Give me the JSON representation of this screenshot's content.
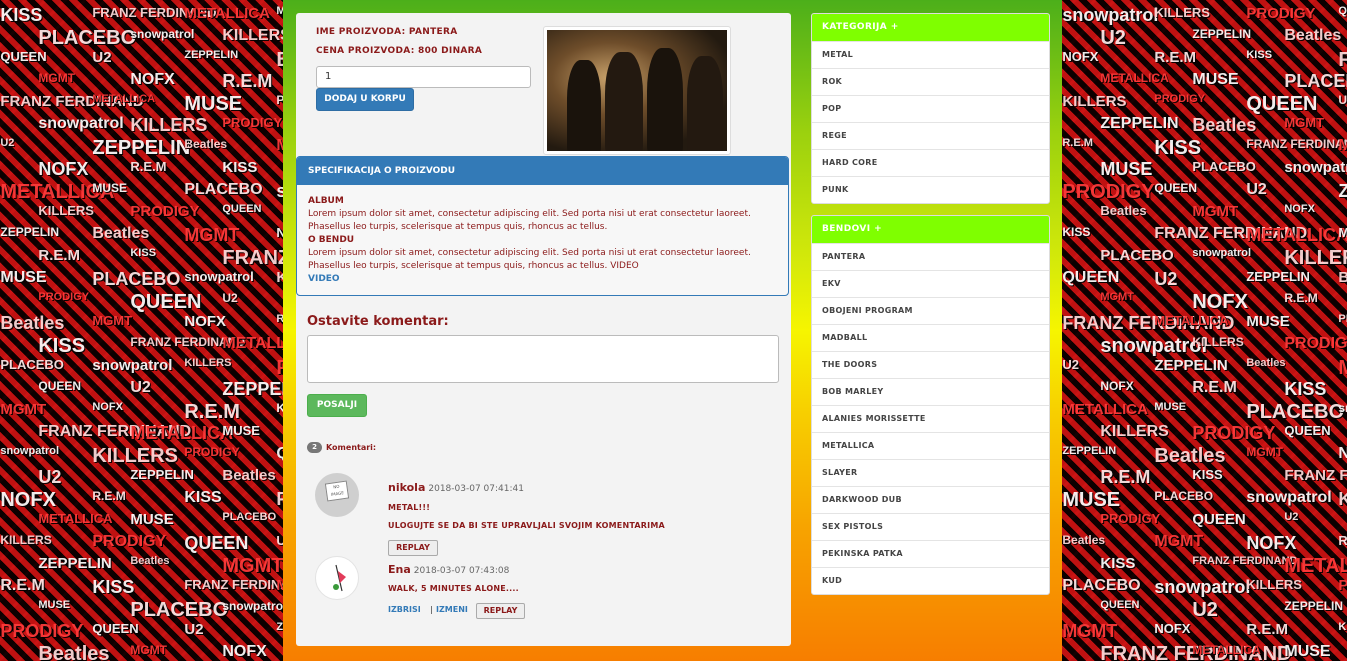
{
  "product": {
    "name_line": "IME PROIZVODA: PANTERA",
    "price_line": "CENA PROIZVODA: 800 DINARA",
    "quantity_value": "1",
    "add_to_cart_label": "DODAJ U KORPU"
  },
  "spec": {
    "heading": "SPECIFIKACIJA O PROIZVODU",
    "album_label": "ALBUM",
    "album_text": "Lorem ipsum dolor sit amet, consectetur adipiscing elit. Sed porta nisi ut erat consectetur laoreet. Phasellus leo turpis, scelerisque at tempus quis, rhoncus ac tellus.",
    "band_label": "O BENDU",
    "band_text": "Lorem ipsum dolor sit amet, consectetur adipiscing elit. Sed porta nisi ut erat consectetur laoreet. Phasellus leo turpis, scelerisque at tempus quis, rhoncus ac tellus. VIDEO",
    "video_link": "VIDEO"
  },
  "comment_form": {
    "label": "Ostavite komentar:",
    "submit_label": "POSALJI"
  },
  "comments_summary": {
    "count": "2",
    "label": "Komentari:"
  },
  "comments": [
    {
      "author": "nikola",
      "date": "2018-03-07 07:41:41",
      "text": "METAL!!!",
      "notice": "ULOGUJTE SE DA BI STE UPRAVLJALI SVOJIM KOMENTARIMA",
      "reply_label": "REPLAY",
      "avatar_text": "NO IMAGE"
    },
    {
      "author": "Ena",
      "date": "2018-03-07 07:43:08",
      "text": "WALK, 5 MINUTES ALONE....",
      "delete_label": "IZBRISI",
      "separator": "|",
      "edit_label": "IZMENI",
      "reply_label": "REPLAY"
    }
  ],
  "categories": {
    "heading": "KATEGORIJA",
    "heading_icon": "+",
    "items": [
      "METAL",
      "ROK",
      "POP",
      "REGE",
      "HARD CORE",
      "PUNK"
    ]
  },
  "bands": {
    "heading": "BENDOVI",
    "heading_icon": "+",
    "items": [
      "PANTERA",
      "EKV",
      "OBOJENI PROGRAM",
      "MADBALL",
      "THE DOORS",
      "BOB MARLEY",
      "ALANIES MORISSETTE",
      "METALLICA",
      "SLAYER",
      "DARKWOOD DUB",
      "SEX PISTOLS",
      "PEKINSKA PATKA",
      "KUD"
    ]
  },
  "colors": {
    "accent_blue": "#337ab7",
    "success_green": "#5cb85c",
    "side_header_green": "#7fff00",
    "text_maroon": "#8b1a1a"
  },
  "wallpaper_words": [
    "KISS",
    "FRANZ FERDINAND",
    "METALLICA",
    "MUSE",
    "PLACEBO",
    "snowpatrol",
    "KILLERS",
    "PRODIGY",
    "QUEEN",
    "U2",
    "ZEPPELIN",
    "Beatles",
    "MGMT",
    "NOFX",
    "R.E.M"
  ]
}
